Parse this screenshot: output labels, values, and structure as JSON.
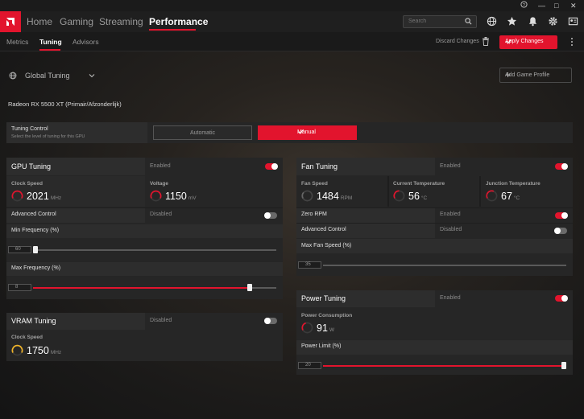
{
  "nav": {
    "items": [
      "Home",
      "Gaming",
      "Streaming",
      "Performance"
    ],
    "search_placeholder": "Search"
  },
  "subnav": {
    "tabs": [
      "Metrics",
      "Tuning",
      "Advisors"
    ],
    "discard": "Discard Changes",
    "apply": "Apply Changes"
  },
  "profile": {
    "name": "Global Tuning",
    "add_label": "Add Game Profile"
  },
  "gpu_name": "Radeon RX 5500 XT (Primair/Afzonderlijk)",
  "tuning_control": {
    "title": "Tuning Control",
    "subtitle": "Select the level of tuning for this GPU",
    "automatic": "Automatic",
    "manual": "Manual"
  },
  "gpu_tuning": {
    "title": "GPU Tuning",
    "state": "Enabled",
    "clock_label": "Clock Speed",
    "clock_value": "2021",
    "clock_unit": "MHz",
    "voltage_label": "Voltage",
    "voltage_value": "1150",
    "voltage_unit": "mV",
    "advanced_label": "Advanced Control",
    "advanced_state": "Disabled",
    "min_freq_label": "Min Frequency (%)",
    "min_freq_value": "60",
    "max_freq_label": "Max Frequency (%)",
    "max_freq_value": "8"
  },
  "vram_tuning": {
    "title": "VRAM Tuning",
    "state": "Disabled",
    "clock_label": "Clock Speed",
    "clock_value": "1750",
    "clock_unit": "MHz"
  },
  "fan_tuning": {
    "title": "Fan Tuning",
    "state": "Enabled",
    "fan_speed_label": "Fan Speed",
    "fan_speed_value": "1484",
    "fan_speed_unit": "RPM",
    "current_temp_label": "Current Temperature",
    "current_temp_value": "56",
    "current_temp_unit": "°C",
    "junction_temp_label": "Junction Temperature",
    "junction_temp_value": "67",
    "junction_temp_unit": "°C",
    "zero_rpm_label": "Zero RPM",
    "zero_rpm_state": "Enabled",
    "advanced_label": "Advanced Control",
    "advanced_state": "Disabled",
    "max_fan_label": "Max Fan Speed (%)",
    "max_fan_value": "35"
  },
  "power_tuning": {
    "title": "Power Tuning",
    "state": "Enabled",
    "consumption_label": "Power Consumption",
    "consumption_value": "91",
    "consumption_unit": "W",
    "limit_label": "Power Limit (%)",
    "limit_value": "20"
  },
  "colors": {
    "accent": "#e2142d",
    "vram_gauge": "#f0b429"
  },
  "icons": [
    "help-icon",
    "minimize-icon",
    "maximize-icon",
    "close-icon",
    "globe-icon",
    "star-icon",
    "bell-icon",
    "gear-icon",
    "account-icon",
    "search-icon",
    "trash-icon",
    "more-icon",
    "chevron-down-icon"
  ]
}
